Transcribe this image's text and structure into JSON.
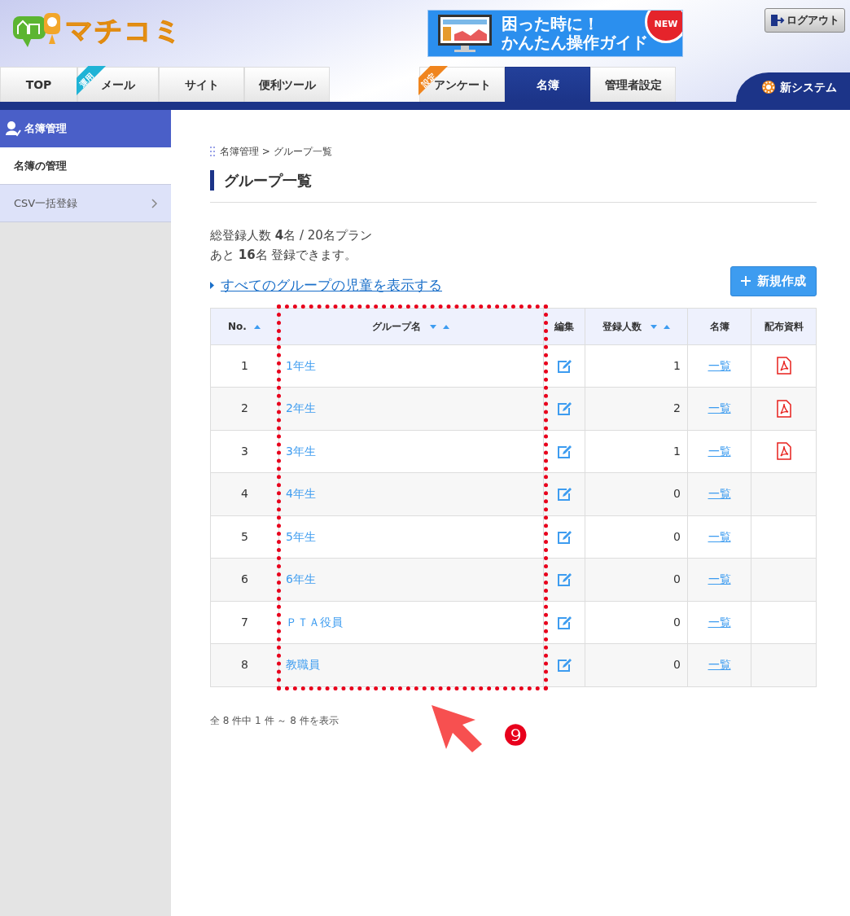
{
  "header": {
    "logo": "マチコミ",
    "guide_banner": {
      "lines": [
        "困った時に！",
        "かんたん操作ガイド"
      ],
      "badge": "NEW"
    },
    "logout": "ログアウト",
    "tabs_left": [
      {
        "label": "TOP",
        "selected": false
      },
      {
        "label": "メール",
        "tag": "運用",
        "selected": false
      },
      {
        "label": "サイト",
        "selected": false
      },
      {
        "label": "便利ツール",
        "selected": false
      }
    ],
    "tabs_right": [
      {
        "label": "アンケート",
        "tag": "設定",
        "selected": false
      },
      {
        "label": "名簿",
        "selected": true
      },
      {
        "label": "管理者設定",
        "selected": false
      }
    ],
    "new_system": "新システム"
  },
  "sidebar": {
    "title": "名簿管理",
    "items": [
      {
        "label": "名簿の管理",
        "selected": true,
        "has_chevron": false
      },
      {
        "label": "CSV一括登録",
        "selected": false,
        "has_chevron": true
      }
    ]
  },
  "breadcrumb": "名簿管理 > グループ一覧",
  "page_title": "グループ一覧",
  "summary": [
    "総登録人数 **4**名 / 20名プラン",
    "あと **16**名 登録できます。"
  ],
  "show_all_link": "すべてのグループの児童を表示する",
  "new_button": "新規作成",
  "table": {
    "columns": [
      {
        "label": "No.",
        "sort_down": false,
        "sort_up": true
      },
      {
        "label": "グループ名",
        "sort_down": true,
        "sort_up": true
      },
      {
        "label": "編集",
        "sort_down": false,
        "sort_up": false
      },
      {
        "label": "登録人数",
        "sort_down": true,
        "sort_up": true
      },
      {
        "label": "名簿",
        "sort_down": false,
        "sort_up": false
      },
      {
        "label": "配布資料",
        "sort_down": false,
        "sort_up": false
      }
    ],
    "rows": [
      {
        "no": "1",
        "name": "1年生",
        "count": "1",
        "roster": "一覧",
        "has_pdf": true
      },
      {
        "no": "2",
        "name": "2年生",
        "count": "2",
        "roster": "一覧",
        "has_pdf": true
      },
      {
        "no": "3",
        "name": "3年生",
        "count": "1",
        "roster": "一覧",
        "has_pdf": true
      },
      {
        "no": "4",
        "name": "4年生",
        "count": "0",
        "roster": "一覧",
        "has_pdf": false
      },
      {
        "no": "5",
        "name": "5年生",
        "count": "0",
        "roster": "一覧",
        "has_pdf": false
      },
      {
        "no": "6",
        "name": "6年生",
        "count": "0",
        "roster": "一覧",
        "has_pdf": false
      },
      {
        "no": "7",
        "name": "ＰＴＡ役員",
        "count": "0",
        "roster": "一覧",
        "has_pdf": false
      },
      {
        "no": "8",
        "name": "教職員",
        "count": "0",
        "roster": "一覧",
        "has_pdf": false
      }
    ]
  },
  "pagination_info": "全 8 件中 1 件 ～ 8 件を表示",
  "annotation": {
    "label": "❾"
  }
}
